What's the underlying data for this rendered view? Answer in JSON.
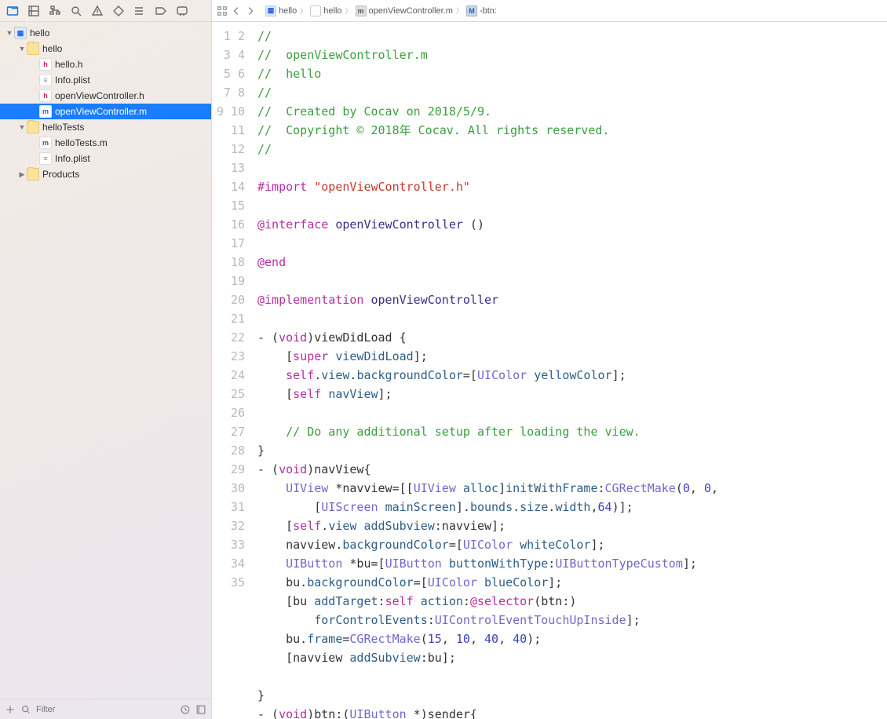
{
  "toolbar_icons": [
    "folder",
    "grid",
    "hierarchy",
    "search",
    "warning",
    "tag",
    "stack",
    "arrow",
    "comment"
  ],
  "jumpbar": {
    "segments": [
      {
        "icon": "obj",
        "label": "hello"
      },
      {
        "icon": "grp",
        "label": "hello"
      },
      {
        "icon": "m",
        "label": "openViewController.m"
      },
      {
        "icon": "meth",
        "label": "-btn:"
      }
    ]
  },
  "tree": [
    {
      "depth": 0,
      "disc": "down",
      "icon": "proj",
      "label": "hello",
      "sel": false
    },
    {
      "depth": 1,
      "disc": "down",
      "icon": "folder",
      "label": "hello",
      "sel": false
    },
    {
      "depth": 2,
      "disc": "",
      "icon": "h",
      "label": "hello.h",
      "sel": false
    },
    {
      "depth": 2,
      "disc": "",
      "icon": "plist",
      "label": "Info.plist",
      "sel": false
    },
    {
      "depth": 2,
      "disc": "",
      "icon": "h",
      "label": "openViewController.h",
      "sel": false
    },
    {
      "depth": 2,
      "disc": "",
      "icon": "mfile",
      "label": "openViewController.m",
      "sel": true
    },
    {
      "depth": 1,
      "disc": "down",
      "icon": "folder",
      "label": "helloTests",
      "sel": false
    },
    {
      "depth": 2,
      "disc": "",
      "icon": "mfile",
      "label": "helloTests.m",
      "sel": false
    },
    {
      "depth": 2,
      "disc": "",
      "icon": "plist",
      "label": "Info.plist",
      "sel": false
    },
    {
      "depth": 1,
      "disc": "right",
      "icon": "folder",
      "label": "Products",
      "sel": false
    }
  ],
  "filter_placeholder": "Filter",
  "code": {
    "lines": [
      [
        {
          "c": "c-comm",
          "t": "//"
        }
      ],
      [
        {
          "c": "c-comm",
          "t": "//  openViewController.m"
        }
      ],
      [
        {
          "c": "c-comm",
          "t": "//  hello"
        }
      ],
      [
        {
          "c": "c-comm",
          "t": "//"
        }
      ],
      [
        {
          "c": "c-comm",
          "t": "//  Created by Cocav on 2018/5/9."
        }
      ],
      [
        {
          "c": "c-comm",
          "t": "//  Copyright © 2018年 Cocav. All rights reserved."
        }
      ],
      [
        {
          "c": "c-comm",
          "t": "//"
        }
      ],
      [
        {
          "t": ""
        }
      ],
      [
        {
          "c": "c-kw",
          "t": "#import "
        },
        {
          "c": "c-str",
          "t": "\"openViewController.h\""
        }
      ],
      [
        {
          "t": ""
        }
      ],
      [
        {
          "c": "c-at",
          "t": "@interface"
        },
        {
          "t": " "
        },
        {
          "c": "c-name",
          "t": "openViewController"
        },
        {
          "t": " ()"
        }
      ],
      [
        {
          "t": ""
        }
      ],
      [
        {
          "c": "c-at",
          "t": "@end"
        }
      ],
      [
        {
          "t": ""
        }
      ],
      [
        {
          "c": "c-at",
          "t": "@implementation"
        },
        {
          "t": " "
        },
        {
          "c": "c-name",
          "t": "openViewController"
        }
      ],
      [
        {
          "t": ""
        }
      ],
      [
        {
          "t": "- ("
        },
        {
          "c": "c-kw",
          "t": "void"
        },
        {
          "t": ")viewDidLoad {"
        }
      ],
      [
        {
          "t": "    ["
        },
        {
          "c": "c-kw",
          "t": "super"
        },
        {
          "t": " "
        },
        {
          "c": "c-msg",
          "t": "viewDidLoad"
        },
        {
          "t": "];"
        }
      ],
      [
        {
          "t": "    "
        },
        {
          "c": "c-kw",
          "t": "self"
        },
        {
          "t": "."
        },
        {
          "c": "c-msg",
          "t": "view"
        },
        {
          "t": "."
        },
        {
          "c": "c-msg",
          "t": "backgroundColor"
        },
        {
          "t": "=["
        },
        {
          "c": "c-type",
          "t": "UIColor"
        },
        {
          "t": " "
        },
        {
          "c": "c-msg",
          "t": "yellowColor"
        },
        {
          "t": "];"
        }
      ],
      [
        {
          "t": "    ["
        },
        {
          "c": "c-kw",
          "t": "self"
        },
        {
          "t": " "
        },
        {
          "c": "c-msg",
          "t": "navView"
        },
        {
          "t": "];"
        }
      ],
      [
        {
          "t": ""
        }
      ],
      [
        {
          "t": "    "
        },
        {
          "c": "c-comm",
          "t": "// Do any additional setup after loading the view."
        }
      ],
      [
        {
          "t": "}"
        }
      ],
      [
        {
          "t": "- ("
        },
        {
          "c": "c-kw",
          "t": "void"
        },
        {
          "t": ")navView{"
        }
      ],
      [
        {
          "t": "    "
        },
        {
          "c": "c-type",
          "t": "UIView"
        },
        {
          "t": " *navview=[["
        },
        {
          "c": "c-type",
          "t": "UIView"
        },
        {
          "t": " "
        },
        {
          "c": "c-msg",
          "t": "alloc"
        },
        {
          "t": "]"
        },
        {
          "c": "c-msg",
          "t": "initWithFrame"
        },
        {
          "t": ":"
        },
        {
          "c": "c-type",
          "t": "CGRectMake"
        },
        {
          "t": "("
        },
        {
          "c": "c-num",
          "t": "0"
        },
        {
          "t": ", "
        },
        {
          "c": "c-num",
          "t": "0"
        },
        {
          "t": ","
        }
      ],
      [
        {
          "t": "        ["
        },
        {
          "c": "c-type",
          "t": "UIScreen"
        },
        {
          "t": " "
        },
        {
          "c": "c-msg",
          "t": "mainScreen"
        },
        {
          "t": "]."
        },
        {
          "c": "c-msg",
          "t": "bounds"
        },
        {
          "t": "."
        },
        {
          "c": "c-msg",
          "t": "size"
        },
        {
          "t": "."
        },
        {
          "c": "c-msg",
          "t": "width"
        },
        {
          "t": ","
        },
        {
          "c": "c-num",
          "t": "64"
        },
        {
          "t": ")];"
        }
      ],
      [
        {
          "t": "    ["
        },
        {
          "c": "c-kw",
          "t": "self"
        },
        {
          "t": "."
        },
        {
          "c": "c-msg",
          "t": "view"
        },
        {
          "t": " "
        },
        {
          "c": "c-msg",
          "t": "addSubview"
        },
        {
          "t": ":navview];"
        }
      ],
      [
        {
          "t": "    navview."
        },
        {
          "c": "c-msg",
          "t": "backgroundColor"
        },
        {
          "t": "=["
        },
        {
          "c": "c-type",
          "t": "UIColor"
        },
        {
          "t": " "
        },
        {
          "c": "c-msg",
          "t": "whiteColor"
        },
        {
          "t": "];"
        }
      ],
      [
        {
          "t": "    "
        },
        {
          "c": "c-type",
          "t": "UIButton"
        },
        {
          "t": " *bu=["
        },
        {
          "c": "c-type",
          "t": "UIButton"
        },
        {
          "t": " "
        },
        {
          "c": "c-msg",
          "t": "buttonWithType"
        },
        {
          "t": ":"
        },
        {
          "c": "c-type",
          "t": "UIButtonTypeCustom"
        },
        {
          "t": "];"
        }
      ],
      [
        {
          "t": "    bu."
        },
        {
          "c": "c-msg",
          "t": "backgroundColor"
        },
        {
          "t": "=["
        },
        {
          "c": "c-type",
          "t": "UIColor"
        },
        {
          "t": " "
        },
        {
          "c": "c-msg",
          "t": "blueColor"
        },
        {
          "t": "];"
        }
      ],
      [
        {
          "t": "    [bu "
        },
        {
          "c": "c-msg",
          "t": "addTarget"
        },
        {
          "t": ":"
        },
        {
          "c": "c-kw",
          "t": "self"
        },
        {
          "t": " "
        },
        {
          "c": "c-msg",
          "t": "action"
        },
        {
          "t": ":"
        },
        {
          "c": "c-kw",
          "t": "@selector"
        },
        {
          "t": "(btn:)"
        }
      ],
      [
        {
          "t": "        "
        },
        {
          "c": "c-msg",
          "t": "forControlEvents"
        },
        {
          "t": ":"
        },
        {
          "c": "c-type",
          "t": "UIControlEventTouchUpInside"
        },
        {
          "t": "];"
        }
      ],
      [
        {
          "t": "    bu."
        },
        {
          "c": "c-msg",
          "t": "frame"
        },
        {
          "t": "="
        },
        {
          "c": "c-type",
          "t": "CGRectMake"
        },
        {
          "t": "("
        },
        {
          "c": "c-num",
          "t": "15"
        },
        {
          "t": ", "
        },
        {
          "c": "c-num",
          "t": "10"
        },
        {
          "t": ", "
        },
        {
          "c": "c-num",
          "t": "40"
        },
        {
          "t": ", "
        },
        {
          "c": "c-num",
          "t": "40"
        },
        {
          "t": ");"
        }
      ],
      [
        {
          "t": "    [navview "
        },
        {
          "c": "c-msg",
          "t": "addSubview"
        },
        {
          "t": ":bu];"
        }
      ],
      [
        {
          "t": ""
        }
      ],
      [
        {
          "t": "}"
        }
      ],
      [
        {
          "t": "- ("
        },
        {
          "c": "c-kw",
          "t": "void"
        },
        {
          "t": ")btn:("
        },
        {
          "c": "c-type",
          "t": "UIButton"
        },
        {
          "t": " *)sender{"
        }
      ]
    ],
    "gutter_numbers_with_sub": [
      "1",
      "2",
      "3",
      "4",
      "5",
      "6",
      "7",
      "8",
      "9",
      "10",
      "11",
      "12",
      "13",
      "14",
      "15",
      "16",
      "17",
      "18",
      "19",
      "20",
      "21",
      "22",
      "23",
      "24",
      "25",
      "",
      "26",
      "27",
      "28",
      "29",
      "30",
      "",
      "31",
      "32",
      "33",
      "34",
      "35"
    ]
  }
}
